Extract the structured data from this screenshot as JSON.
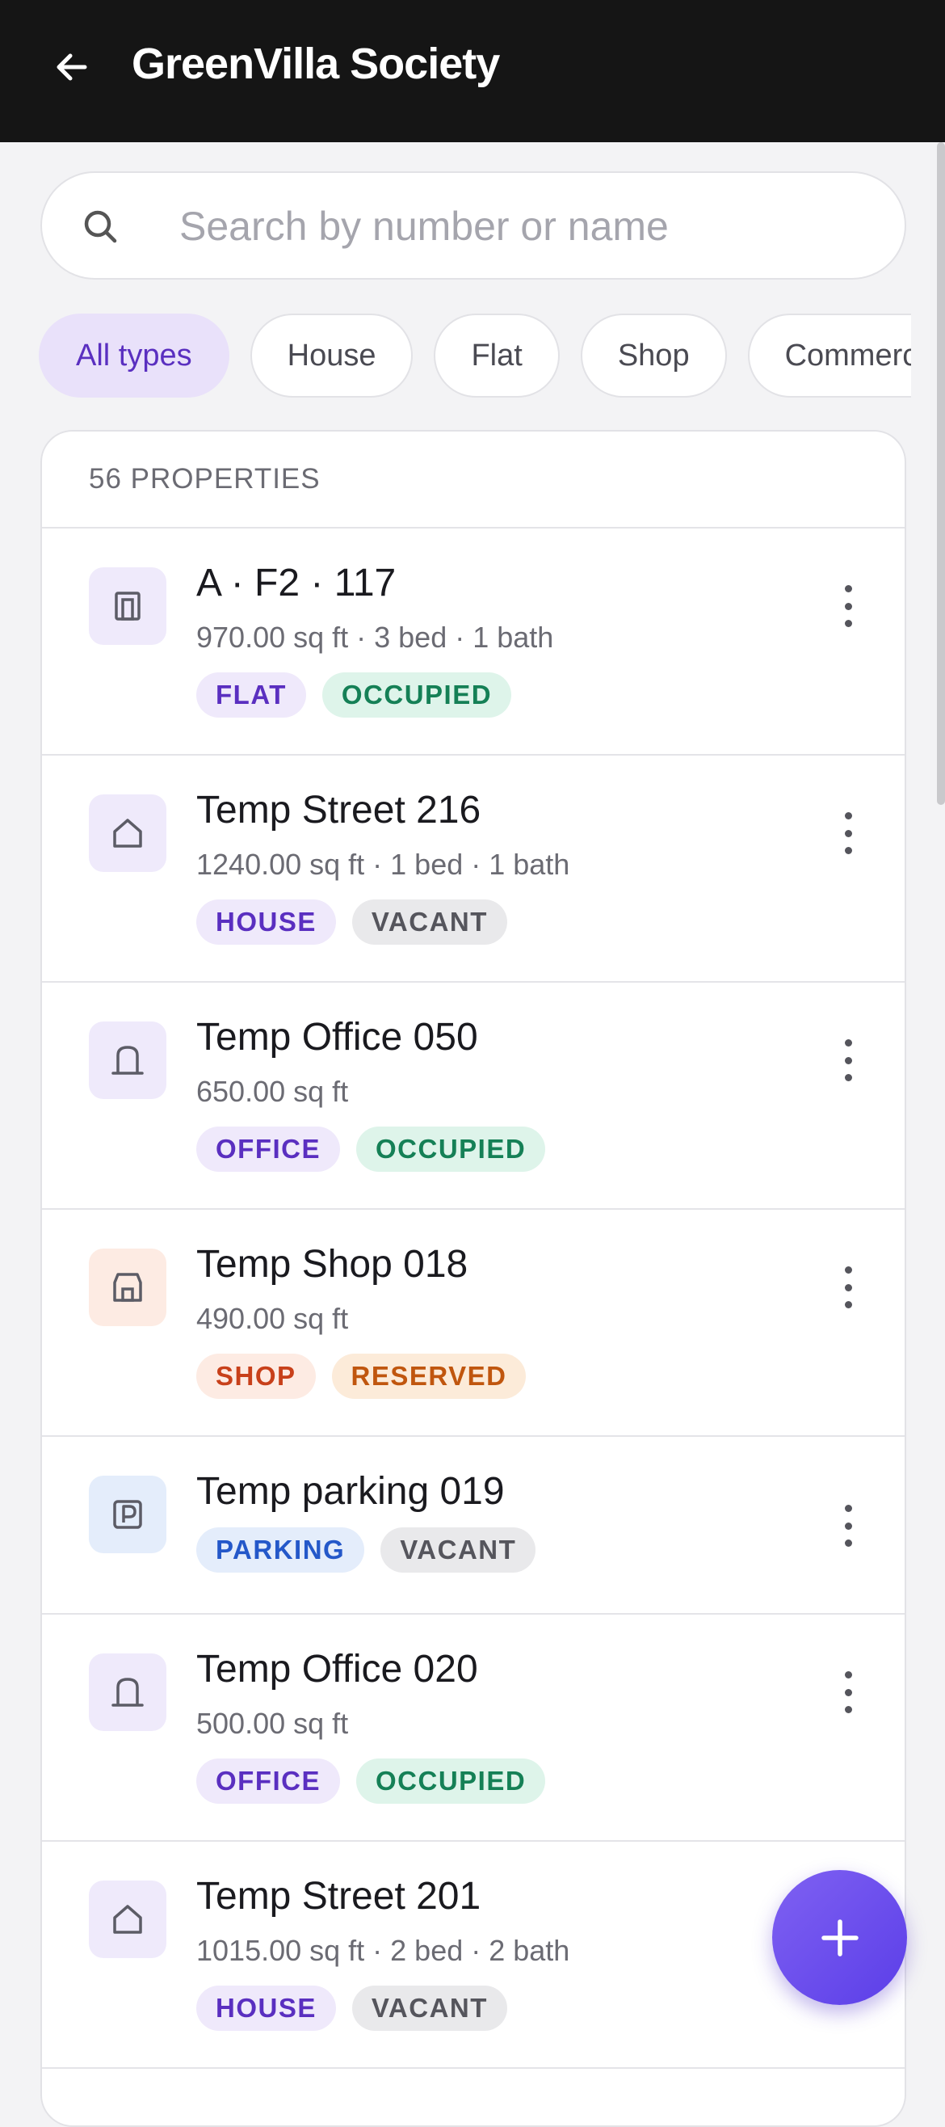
{
  "header": {
    "title": "GreenVilla Society",
    "back_icon": "arrow-left-icon"
  },
  "search": {
    "placeholder": "Search by number or name",
    "value": "",
    "icon": "search-icon"
  },
  "filters": [
    {
      "label": "All types",
      "active": true
    },
    {
      "label": "House",
      "active": false
    },
    {
      "label": "Flat",
      "active": false
    },
    {
      "label": "Shop",
      "active": false
    },
    {
      "label": "Commercial",
      "active": false
    }
  ],
  "list": {
    "count_label": "56 PROPERTIES",
    "properties": [
      {
        "name": "A · F2 · 117",
        "details": "970.00 sq ft · 3 bed · 1 bath",
        "icon": "flat-icon",
        "type": "FLAT",
        "status": "OCCUPIED"
      },
      {
        "name": "Temp Street 216",
        "details": "1240.00 sq ft · 1 bed · 1 bath",
        "icon": "house-icon",
        "type": "HOUSE",
        "status": "VACANT"
      },
      {
        "name": "Temp Office 050",
        "details": "650.00 sq ft",
        "icon": "office-icon",
        "type": "OFFICE",
        "status": "OCCUPIED"
      },
      {
        "name": "Temp Shop 018",
        "details": "490.00 sq ft",
        "icon": "shop-icon",
        "type": "SHOP",
        "status": "RESERVED"
      },
      {
        "name": "Temp parking 019",
        "details": "",
        "icon": "parking-icon",
        "type": "PARKING",
        "status": "VACANT"
      },
      {
        "name": "Temp Office 020",
        "details": "500.00 sq ft",
        "icon": "office-icon",
        "type": "OFFICE",
        "status": "OCCUPIED"
      },
      {
        "name": "Temp Street 201",
        "details": "1015.00 sq ft · 2 bed · 2 bath",
        "icon": "house-icon",
        "type": "HOUSE",
        "status": "VACANT"
      }
    ]
  },
  "fab": {
    "icon": "plus-icon"
  },
  "colors": {
    "appbar": "#151515",
    "accent": "#6a4cf0",
    "type_default_bg": "#efe9fb",
    "type_default_fg": "#5a2fc0",
    "type_shop_bg": "#fdebe3",
    "type_shop_fg": "#c8401a",
    "type_parking_bg": "#e4edfb",
    "type_parking_fg": "#2458c9",
    "status_occupied_bg": "#def4ea",
    "status_occupied_fg": "#158056",
    "status_vacant_bg": "#e9e9eb",
    "status_vacant_fg": "#55555c",
    "status_reserved_bg": "#fcebd9",
    "status_reserved_fg": "#c0560e"
  }
}
